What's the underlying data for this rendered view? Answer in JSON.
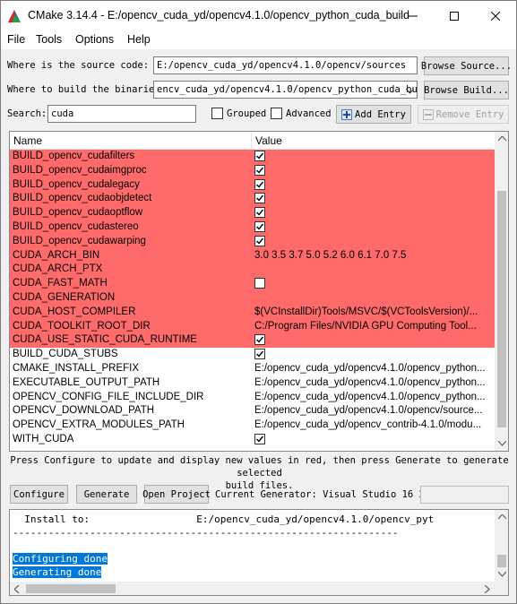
{
  "window": {
    "title": "CMake 3.14.4 - E:/opencv_cuda_yd/opencv4.1.0/opencv_python_cuda_build"
  },
  "menu": [
    "File",
    "Tools",
    "Options",
    "Help"
  ],
  "source": {
    "label": "Where is the source code:",
    "value": "E:/opencv_cuda_yd/opencv4.1.0/opencv/sources",
    "browse_label": "Browse Source..."
  },
  "build": {
    "label": "Where to build the binaries:",
    "value": "encv_cuda_yd/opencv4.1.0/opencv_python_cuda_build",
    "browse_label": "Browse Build..."
  },
  "search": {
    "label": "Search:",
    "value": "cuda",
    "grouped_label": "Grouped",
    "grouped_checked": false,
    "advanced_label": "Advanced",
    "advanced_checked": false,
    "add_entry_label": "Add Entry",
    "remove_entry_label": "Remove Entry"
  },
  "table": {
    "headers": [
      "Name",
      "Value"
    ],
    "new_color": "#ff6a6a",
    "rows": [
      {
        "name": "BUILD_opencv_cudafilters",
        "type": "bool",
        "checked": true,
        "value": "",
        "new": true
      },
      {
        "name": "BUILD_opencv_cudaimgproc",
        "type": "bool",
        "checked": true,
        "value": "",
        "new": true
      },
      {
        "name": "BUILD_opencv_cudalegacy",
        "type": "bool",
        "checked": true,
        "value": "",
        "new": true
      },
      {
        "name": "BUILD_opencv_cudaobjdetect",
        "type": "bool",
        "checked": true,
        "value": "",
        "new": true
      },
      {
        "name": "BUILD_opencv_cudaoptflow",
        "type": "bool",
        "checked": true,
        "value": "",
        "new": true
      },
      {
        "name": "BUILD_opencv_cudastereo",
        "type": "bool",
        "checked": true,
        "value": "",
        "new": true
      },
      {
        "name": "BUILD_opencv_cudawarping",
        "type": "bool",
        "checked": true,
        "value": "",
        "new": true
      },
      {
        "name": "CUDA_ARCH_BIN",
        "type": "text",
        "checked": false,
        "value": "3.0 3.5 3.7 5.0 5.2 6.0 6.1 7.0 7.5",
        "new": true
      },
      {
        "name": "CUDA_ARCH_PTX",
        "type": "text",
        "checked": false,
        "value": "",
        "new": true
      },
      {
        "name": "CUDA_FAST_MATH",
        "type": "bool",
        "checked": false,
        "value": "",
        "new": true
      },
      {
        "name": "CUDA_GENERATION",
        "type": "text",
        "checked": false,
        "value": "",
        "new": true
      },
      {
        "name": "CUDA_HOST_COMPILER",
        "type": "text",
        "checked": false,
        "value": "$(VCInstallDir)Tools/MSVC/$(VCToolsVersion)/...",
        "new": true
      },
      {
        "name": "CUDA_TOOLKIT_ROOT_DIR",
        "type": "text",
        "checked": false,
        "value": "C:/Program Files/NVIDIA GPU Computing Tool...",
        "new": true
      },
      {
        "name": "CUDA_USE_STATIC_CUDA_RUNTIME",
        "type": "bool",
        "checked": true,
        "value": "",
        "new": true
      },
      {
        "name": "BUILD_CUDA_STUBS",
        "type": "bool",
        "checked": true,
        "value": "",
        "new": false
      },
      {
        "name": "CMAKE_INSTALL_PREFIX",
        "type": "text",
        "checked": false,
        "value": "E:/opencv_cuda_yd/opencv4.1.0/opencv_python...",
        "new": false
      },
      {
        "name": "EXECUTABLE_OUTPUT_PATH",
        "type": "text",
        "checked": false,
        "value": "E:/opencv_cuda_yd/opencv4.1.0/opencv_python...",
        "new": false
      },
      {
        "name": "OPENCV_CONFIG_FILE_INCLUDE_DIR",
        "type": "text",
        "checked": false,
        "value": "E:/opencv_cuda_yd/opencv4.1.0/opencv_python...",
        "new": false
      },
      {
        "name": "OPENCV_DOWNLOAD_PATH",
        "type": "text",
        "checked": false,
        "value": "E:/opencv_cuda_yd/opencv4.1.0/opencv/source...",
        "new": false
      },
      {
        "name": "OPENCV_EXTRA_MODULES_PATH",
        "type": "text",
        "checked": false,
        "value": "E:/opencv_cuda_yd/opencv_contrib-4.1.0/modu...",
        "new": false
      },
      {
        "name": "WITH_CUDA",
        "type": "bool",
        "checked": true,
        "value": "",
        "new": false
      }
    ]
  },
  "hint": {
    "line1": "Press Configure to update and display new values in red, then press Generate to generate selected",
    "line2": "build files."
  },
  "actions": {
    "configure": "Configure",
    "generate": "Generate",
    "open_project": "Open Project",
    "generator": "Current Generator: Visual Studio 16 2019"
  },
  "output": {
    "install_line": "  Install to:                  E:/opencv_cuda_yd/opencv4.1.0/opencv_pyt",
    "separator": "-----------------------------------------------------------------",
    "configuring_done": "Configuring done",
    "generating_done": "Generating done",
    "selection_color": "#0078d7"
  }
}
